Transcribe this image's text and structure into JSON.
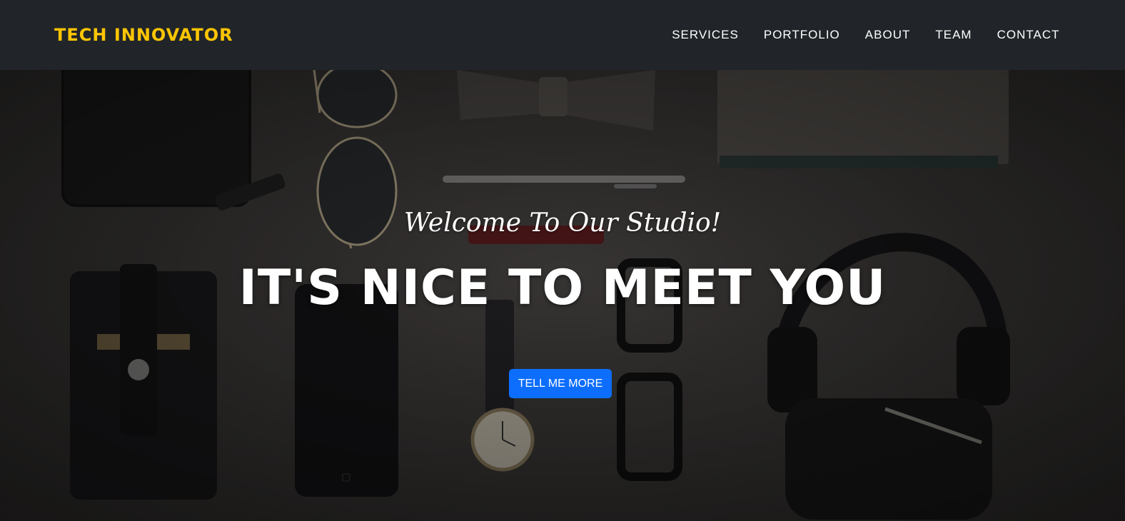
{
  "navbar": {
    "brand": "TECH INNOVATOR",
    "links": [
      "SERVICES",
      "PORTFOLIO",
      "ABOUT",
      "TEAM",
      "CONTACT"
    ]
  },
  "hero": {
    "subheading": "Welcome To Our Studio!",
    "heading": "IT'S NICE TO MEET YOU",
    "button_label": "TELL ME MORE",
    "background_description_icons": [
      "wallet-icon",
      "sunglasses-icon",
      "bow-tie-icon",
      "notebook-icon",
      "pen-icon",
      "headphones-icon",
      "card-holder-icon",
      "smartphone-icon",
      "watch-icon",
      "eyeglasses-icon",
      "lipstick-icon"
    ]
  },
  "colors": {
    "navbar_bg": "#212529",
    "brand": "#fec503",
    "nav_text": "#ffffff",
    "button_bg": "#0d6efd",
    "hero_text": "#ffffff"
  }
}
